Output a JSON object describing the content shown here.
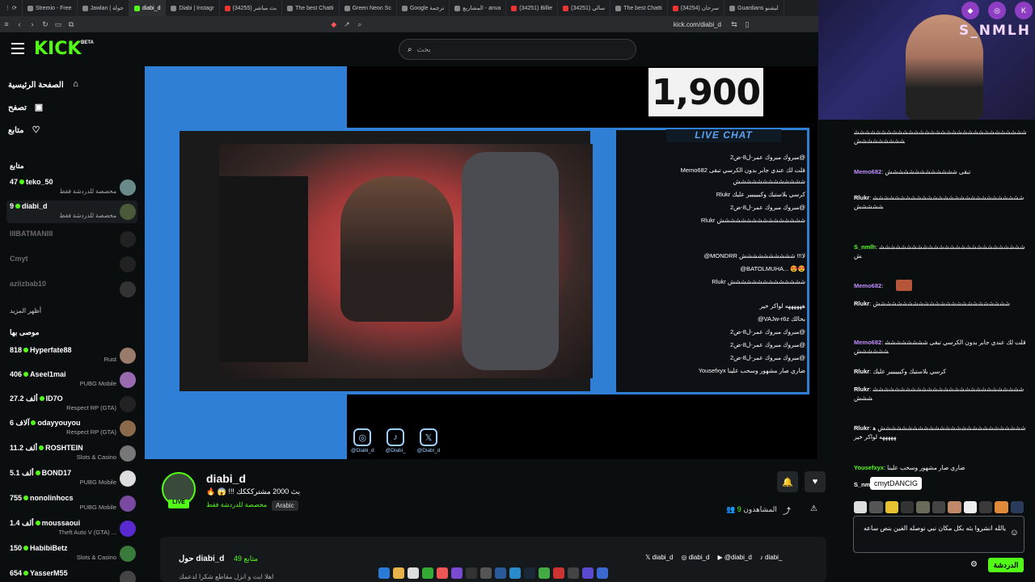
{
  "tabs": [
    "Stremio - Free",
    "Jawlan | جولة",
    "diabi_d",
    "Diabi | Instagr",
    "بث مباشر (34255)",
    "The best Chatti",
    "Green Neon Sc",
    "Google ترجمة",
    "المشاريع - anva",
    "(34251) Billie",
    "(34251) سالي",
    "The best Chatti",
    "(34254) سرحان",
    "Guardians ليشنو"
  ],
  "address": "kick.com/diabi_d",
  "site": {
    "logo": "KICK",
    "beta": "BETA",
    "search_placeholder": "بحث"
  },
  "nav": [
    {
      "label": "الصفحة الرئيسية",
      "icon": "home-icon"
    },
    {
      "label": "تصفح",
      "icon": "browse-icon"
    },
    {
      "label": "متابع",
      "icon": "heart-icon"
    }
  ],
  "sections": {
    "following": "متابع",
    "show_more": "أظهر المزيد",
    "recommended": "موصى بها"
  },
  "following": [
    {
      "count": "47",
      "name": "teko_50",
      "sub": "مخصصة للدردشة فقط",
      "live": true
    },
    {
      "count": "9",
      "name": "diabi_d",
      "sub": "مخصصة للدردشة فقط",
      "live": true
    },
    {
      "count": "",
      "name": "IIIBATMANIII",
      "sub": "",
      "live": false
    },
    {
      "count": "",
      "name": "Cmyt",
      "sub": "",
      "live": false
    },
    {
      "count": "",
      "name": "aziizbab10",
      "sub": "",
      "live": false
    }
  ],
  "recommended": [
    {
      "count": "818",
      "name": "Hyperfate88",
      "sub": "Rust"
    },
    {
      "count": "406",
      "name": "Aseel1mai",
      "sub": "PUBG Mobile"
    },
    {
      "count": "27.2 ألف",
      "name": "ID7O",
      "sub": "Respect RP (GTA)"
    },
    {
      "count": "6 آلاف",
      "name": "odayyouyou",
      "sub": "Respect RP (GTA)"
    },
    {
      "count": "11.2 ألف",
      "name": "ROSHTEIN",
      "sub": "Slots & Casino"
    },
    {
      "count": "5.1 ألف",
      "name": "BOND17",
      "sub": "PUBG Mobile"
    },
    {
      "count": "755",
      "name": "nonolinhocs",
      "sub": "PUBG Mobile"
    },
    {
      "count": "1.4 ألف",
      "name": "moussaoui",
      "sub": "Theft Auto V (GTA) ..."
    },
    {
      "count": "150",
      "name": "HabibiBetz",
      "sub": "Slots & Casino"
    },
    {
      "count": "654",
      "name": "YasserM55",
      "sub": ""
    }
  ],
  "overlay": {
    "counter": "1,900",
    "live_chat": "LIVE CHAT",
    "chat": [
      "مبروك مبروك عمر-ل8-ض2@",
      "مبروك مبروك عمر-ل8-ض2@",
      "Memo682 قلت لك عندي جابر بدون الكرسي تبقى",
      "ششششششششششششش",
      "Rlukr كرسي بلاستيك وكيييييير عليك",
      "مبروك مبروك عمر-ل8-ض2@",
      "Rlukr شششششششششششششششش",
      "@MONDRR لا!!! شششششششششش",
      "@BATOLMUHA... 😍😍",
      "Rlukr شششششششششششششش",
      "ههههههه لواكر خير",
      "@VAJw-r6z بحالك",
      "مبروك مبروك عمر-ل8-ض2@",
      "مبروك مبروك عمر-ل8-ض2@",
      "مبروك مبروك عمر-ل8-ض2@",
      "Yousefxyx ضاري صار مشهور وسحب علينا"
    ],
    "socials": [
      {
        "icon": "instagram-icon",
        "glyph": "◎",
        "handle": "@Diabi_d"
      },
      {
        "icon": "tiktok-icon",
        "glyph": "♪",
        "handle": "@Diabi_"
      },
      {
        "icon": "x-icon",
        "glyph": "𝕏",
        "handle": "@Diabi_d"
      }
    ]
  },
  "stream": {
    "channel": "diabi_d",
    "title": "🔥 😱 !!! بث 2000 مشتركككك",
    "category": "مخصصة للدردشة فقط",
    "language": "Arabic",
    "live": "LIVE",
    "viewers_label": "المشاهدون",
    "viewers": "9"
  },
  "about": {
    "label": "حول diabi_d",
    "followers": "49 متابع",
    "description": "اهلا ابث و انزل مقاطع شكرا لدعمك",
    "socials": [
      "diabi_d",
      "diabi_d",
      "@diabi_d",
      "diabi_"
    ]
  },
  "webcam": {
    "name": "S_NMLH"
  },
  "chat": [
    {
      "user": "",
      "text": "ششششششششششششششششششششششششششششششششششششششششش"
    },
    {
      "user": "Memo682",
      "text": "تبقى ششششششششششششش"
    },
    {
      "user": "Rlukr",
      "text": "ششششششششششششششششششششششششششششششششش"
    },
    {
      "user": "S_nmlh",
      "text": "شششششششششششششششششششششششششششش"
    },
    {
      "user": "Memo682",
      "text": "[emote]"
    },
    {
      "user": "Rlukr",
      "text": "ششششششششششششششششششششششششش"
    },
    {
      "user": "Memo682",
      "text": "قلت لك عندي جابر بدون الكرسي تبقى شششششششششششششش"
    },
    {
      "user": "Rlukr",
      "text": "كرسي بلاستيك وكيييييير عليك"
    },
    {
      "user": "Rlukr",
      "text": "ششششششششششششششششششششششششششششششش"
    },
    {
      "user": "Rlukr",
      "text": "ششششششششششششششششششششششششششش ههههههه لواكر خير"
    },
    {
      "user": "Yousefxyx",
      "text": "ضاري صار مشهور وسحب علينا"
    },
    {
      "user": "S_nm",
      "text": ""
    }
  ],
  "tooltip": "cmytDANCIG",
  "chat_input": "يالله انشروا بثه بكل مكان نبي نوصله الفين بنص ساعه",
  "chat_button": "الدردشة"
}
